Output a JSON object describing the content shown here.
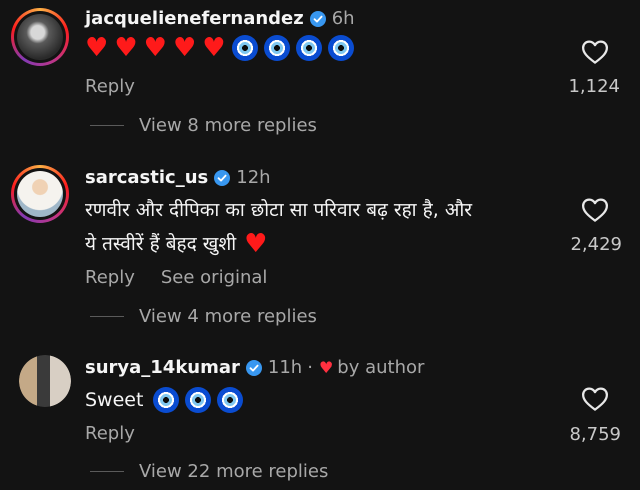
{
  "comments": [
    {
      "username": "jacquelienefernandez",
      "time": "6h",
      "hearts": 5,
      "nazars": 4,
      "reply_label": "Reply",
      "likes": "1,124",
      "view_replies": "View 8 more replies"
    },
    {
      "username": "sarcastic_us",
      "time": "12h",
      "text_line1": "रणवीर और दीपिका का छोटा सा परिवार बढ़ रहा है, और",
      "text_line2": "ये तस्वीरें हैं बेहद खुशी",
      "reply_label": "Reply",
      "see_original_label": "See original",
      "likes": "2,429",
      "view_replies": "View 4 more replies"
    },
    {
      "username": "surya_14kumar",
      "time": "11h",
      "separator": "·",
      "by_author": "by author",
      "text": "Sweet",
      "nazars": 3,
      "reply_label": "Reply",
      "likes": "8,759",
      "view_replies": "View 22 more replies"
    }
  ],
  "colors": {
    "background": "#131313",
    "verified": "#3897f0",
    "heart": "#ff3040",
    "secondary_text": "#a8a8a8"
  },
  "icons": [
    "verified-badge-icon",
    "heart-outline-icon",
    "red-heart-emoji",
    "nazar-amulet-emoji"
  ]
}
